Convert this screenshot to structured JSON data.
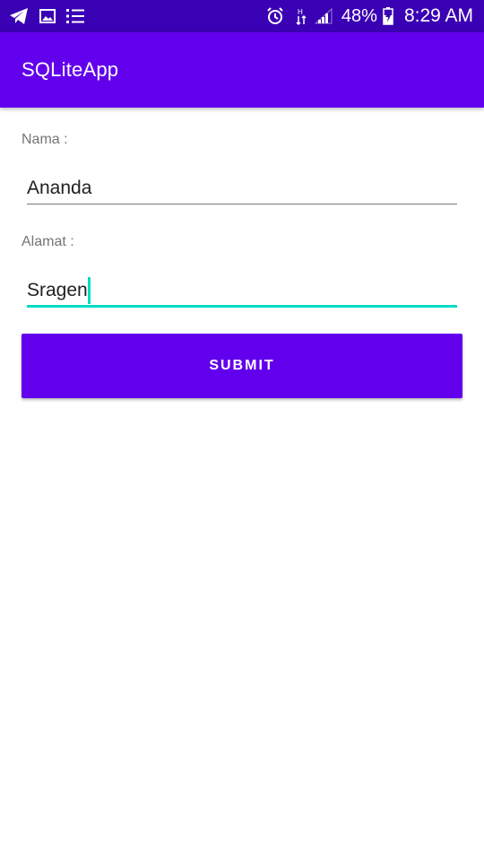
{
  "status_bar": {
    "left_icons": [
      "telegram-icon",
      "image-icon",
      "list-icon"
    ],
    "right_icons": [
      "alarm-icon",
      "data-arrows-icon",
      "signal-icon",
      "battery-charging-icon"
    ],
    "battery_percent": "48%",
    "time": "8:29 AM"
  },
  "app_bar": {
    "title": "SQLiteApp"
  },
  "form": {
    "nama_label": "Nama :",
    "nama_value": "Ananda",
    "alamat_label": "Alamat :",
    "alamat_value": "Sragen",
    "submit_label": "SUBMIT"
  },
  "colors": {
    "status_bar": "#3a00b3",
    "primary": "#6200ee",
    "accent": "#03dac5",
    "label_text": "#757575"
  }
}
